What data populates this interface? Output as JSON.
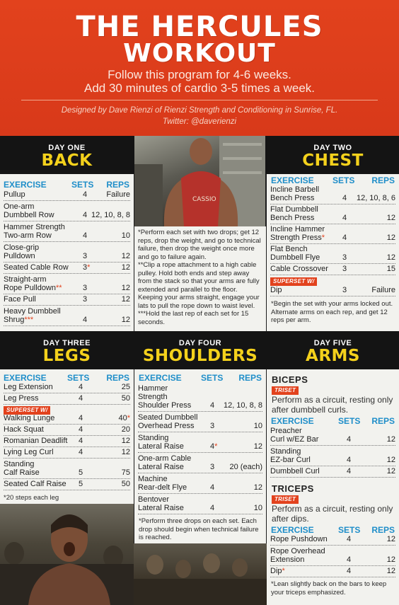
{
  "header": {
    "title_line1": "THE HERCULES",
    "title_line2": "WORKOUT",
    "subtitle_line1": "Follow this program for 4-6 weeks.",
    "subtitle_line2": "Add 30 minutes of cardio 3-5 times a week.",
    "credit_line1": "Designed by Dave Rienzi of Rienzi Strength and Conditioning in Sunrise, FL.",
    "credit_line2": "Twitter: @daverienzi"
  },
  "columns": {
    "exercise": "EXERCISE",
    "sets": "SETS",
    "reps": "REPS"
  },
  "day1": {
    "label": "DAY ONE",
    "title": "BACK",
    "rows": [
      {
        "exercise": [
          "Pullup"
        ],
        "sets": "4",
        "reps": "Failure"
      },
      {
        "exercise": [
          "One-arm",
          "Dumbbell Row"
        ],
        "sets": "4",
        "reps": "12, 10, 8, 8"
      },
      {
        "exercise": [
          "Hammer Strength",
          "Two-arm Row"
        ],
        "sets": "4",
        "reps": "10"
      },
      {
        "exercise": [
          "Close-grip",
          "Pulldown"
        ],
        "sets": "3",
        "reps": "12"
      },
      {
        "exercise": [
          "Seated Cable Row"
        ],
        "sets": "3",
        "sets_mark": "*",
        "reps": "12"
      },
      {
        "exercise": [
          "Straight-arm",
          "Rope Pulldown"
        ],
        "exercise_mark": "**",
        "sets": "3",
        "reps": "12"
      },
      {
        "exercise": [
          "Face Pull"
        ],
        "sets": "3",
        "reps": "12"
      },
      {
        "exercise": [
          "Heavy Dumbbell",
          "Shrug"
        ],
        "exercise_mark": "***",
        "sets": "4",
        "reps": "12"
      }
    ],
    "notes": [
      "*Perform each set with two drops; get 12 reps, drop the weight, and go to technical failure, then drop the weight once more and go to failure again.",
      "**Clip a rope attachment to a high cable pulley. Hold both ends and step away from the stack so that your arms are fully extended and parallel to the floor. Keeping your arms straight, engage your lats to pull the rope down to waist level.",
      "***Hold the last rep of each set for 15 seconds."
    ]
  },
  "day2": {
    "label": "DAY TWO",
    "title": "CHEST",
    "rows": [
      {
        "exercise": [
          "Incline Barbell",
          "Bench Press"
        ],
        "sets": "4",
        "reps": "12, 10, 8, 6"
      },
      {
        "exercise": [
          "Flat Dumbbell",
          "Bench Press"
        ],
        "sets": "4",
        "reps": "12"
      },
      {
        "exercise": [
          "Incline Hammer",
          "Strength Press"
        ],
        "exercise_mark": "*",
        "sets": "4",
        "reps": "12"
      },
      {
        "exercise": [
          "Flat Bench",
          "Dumbbell Flye"
        ],
        "sets": "3",
        "reps": "12"
      },
      {
        "exercise": [
          "Cable Crossover"
        ],
        "sets": "3",
        "reps": "15"
      },
      {
        "exercise": [
          "Dip"
        ],
        "sets": "3",
        "reps": "Failure"
      }
    ],
    "superset": "SUPERSET W/",
    "note": "*Begin the set with your arms locked out. Alternate arms on each rep, and get 12 reps per arm."
  },
  "day3": {
    "label": "DAY THREE",
    "title": "LEGS",
    "rows": [
      {
        "exercise": [
          "Leg Extension"
        ],
        "sets": "4",
        "reps": "25"
      },
      {
        "exercise": [
          "Leg Press"
        ],
        "sets": "4",
        "reps": "50"
      },
      {
        "exercise": [
          "Walking Lunge"
        ],
        "sets": "4",
        "reps": "40",
        "reps_mark": "*"
      },
      {
        "exercise": [
          "Hack Squat"
        ],
        "sets": "4",
        "reps": "20"
      },
      {
        "exercise": [
          "Romanian Deadlift"
        ],
        "sets": "4",
        "reps": "12"
      },
      {
        "exercise": [
          "Lying Leg Curl"
        ],
        "sets": "4",
        "reps": "12"
      },
      {
        "exercise": [
          "Standing",
          "Calf Raise"
        ],
        "sets": "5",
        "reps": "75"
      },
      {
        "exercise": [
          "Seated Calf Raise"
        ],
        "sets": "5",
        "reps": "50"
      }
    ],
    "superset": "SUPERSET W/",
    "note": "*20 steps each leg"
  },
  "day4": {
    "label": "DAY FOUR",
    "title": "SHOULDERS",
    "rows": [
      {
        "exercise": [
          "Hammer",
          "Strength",
          "Shoulder Press"
        ],
        "sets": "4",
        "reps": "12, 10, 8, 8"
      },
      {
        "exercise": [
          "Seated Dumbbell",
          "Overhead Press"
        ],
        "sets": "3",
        "reps": "10"
      },
      {
        "exercise": [
          "Standing",
          "Lateral Raise"
        ],
        "sets": "4",
        "sets_mark": "*",
        "reps": "12"
      },
      {
        "exercise": [
          "One-arm Cable",
          "Lateral Raise"
        ],
        "sets": "3",
        "reps": "20 (each)"
      },
      {
        "exercise": [
          "Machine",
          "Rear-delt Flye"
        ],
        "sets": "4",
        "reps": "12"
      },
      {
        "exercise": [
          "Bentover",
          "Lateral Raise"
        ],
        "sets": "4",
        "reps": "10"
      }
    ],
    "note": "*Perform three drops on each set. Each drop should begin when technical failure is reached."
  },
  "day5": {
    "label": "DAY FIVE",
    "title": "ARMS",
    "biceps_title": "BICEPS",
    "triceps_title": "TRICEPS",
    "triset": "TRISET",
    "biceps_desc": "Perform as a circuit, resting only after dumbbell curls.",
    "triceps_desc": "Perform as a circuit, resting only after dips.",
    "biceps_rows": [
      {
        "exercise": [
          "Preacher",
          "Curl w/EZ Bar"
        ],
        "sets": "4",
        "reps": "12"
      },
      {
        "exercise": [
          "Standing",
          "EZ-bar Curl"
        ],
        "sets": "4",
        "reps": "12"
      },
      {
        "exercise": [
          "Dumbbell Curl"
        ],
        "sets": "4",
        "reps": "12"
      }
    ],
    "triceps_rows": [
      {
        "exercise": [
          "Rope Pushdown"
        ],
        "sets": "4",
        "reps": "12"
      },
      {
        "exercise": [
          "Rope Overhead",
          "Extension"
        ],
        "sets": "4",
        "reps": "12"
      },
      {
        "exercise": [
          "Dip"
        ],
        "exercise_mark": "*",
        "sets": "4",
        "reps": "12"
      }
    ],
    "note": "*Lean slightly back on the bars to keep your triceps emphasized."
  }
}
